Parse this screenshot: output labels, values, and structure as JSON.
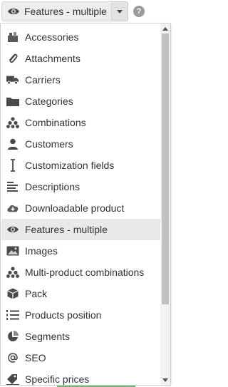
{
  "toolbar": {
    "selected_label": "Features - multiple",
    "selected_icon": "eye-icon",
    "help_label": "?"
  },
  "menu": {
    "items": [
      {
        "label": "Accessories",
        "icon": "accessories-icon"
      },
      {
        "label": "Attachments",
        "icon": "paperclip-icon"
      },
      {
        "label": "Carriers",
        "icon": "truck-icon"
      },
      {
        "label": "Categories",
        "icon": "folder-icon"
      },
      {
        "label": "Combinations",
        "icon": "combinations-icon"
      },
      {
        "label": "Customers",
        "icon": "user-icon"
      },
      {
        "label": "Customization fields",
        "icon": "text-cursor-icon"
      },
      {
        "label": "Descriptions",
        "icon": "align-left-icon"
      },
      {
        "label": "Downloadable product",
        "icon": "cloud-download-icon"
      },
      {
        "label": "Features - multiple",
        "icon": "eye-icon",
        "active": true
      },
      {
        "label": "Images",
        "icon": "image-icon"
      },
      {
        "label": "Multi-product combinations",
        "icon": "combinations-icon"
      },
      {
        "label": "Pack",
        "icon": "box-icon"
      },
      {
        "label": "Products position",
        "icon": "list-ordered-icon"
      },
      {
        "label": "Segments",
        "icon": "pie-chart-icon"
      },
      {
        "label": "SEO",
        "icon": "at-icon"
      },
      {
        "label": "Specific prices",
        "icon": "price-tag-icon"
      }
    ]
  },
  "colors": {
    "active_bg": "#e9e9e9",
    "text": "#2f3337",
    "icon": "#4a4a4a",
    "accent_green": "#70b580"
  }
}
